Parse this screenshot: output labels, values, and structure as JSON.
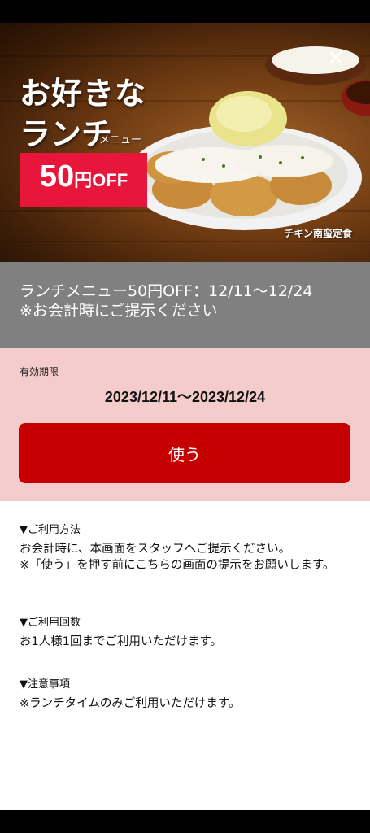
{
  "hero": {
    "headline_line1": "お好きな",
    "headline_line2": "ランチ",
    "headline_line2_sub": "メニュー",
    "badge_number": "50",
    "badge_yen": "円",
    "badge_off": "OFF",
    "caption": "チキン南蛮定食"
  },
  "banner": {
    "line1": "ランチメニュー50円OFF：12/11〜12/24",
    "line2": "※お会計時にご提示ください"
  },
  "validity": {
    "label": "有効期限",
    "value": "2023/12/11〜2023/12/24",
    "use_button_label": "使う"
  },
  "info": {
    "method_heading": "▼ご利用方法",
    "method_line1": "お会計時に、本画面をスタッフへご提示ください。",
    "method_line2": "※「使う」を押す前にこちらの画面の提示をお願いします。",
    "count_heading": "▼ご利用回数",
    "count_body": "お1人様1回までご利用いただけます。",
    "notes_heading": "▼注意事項",
    "notes_body": "※ランチタイムのみご利用いただけます。"
  }
}
